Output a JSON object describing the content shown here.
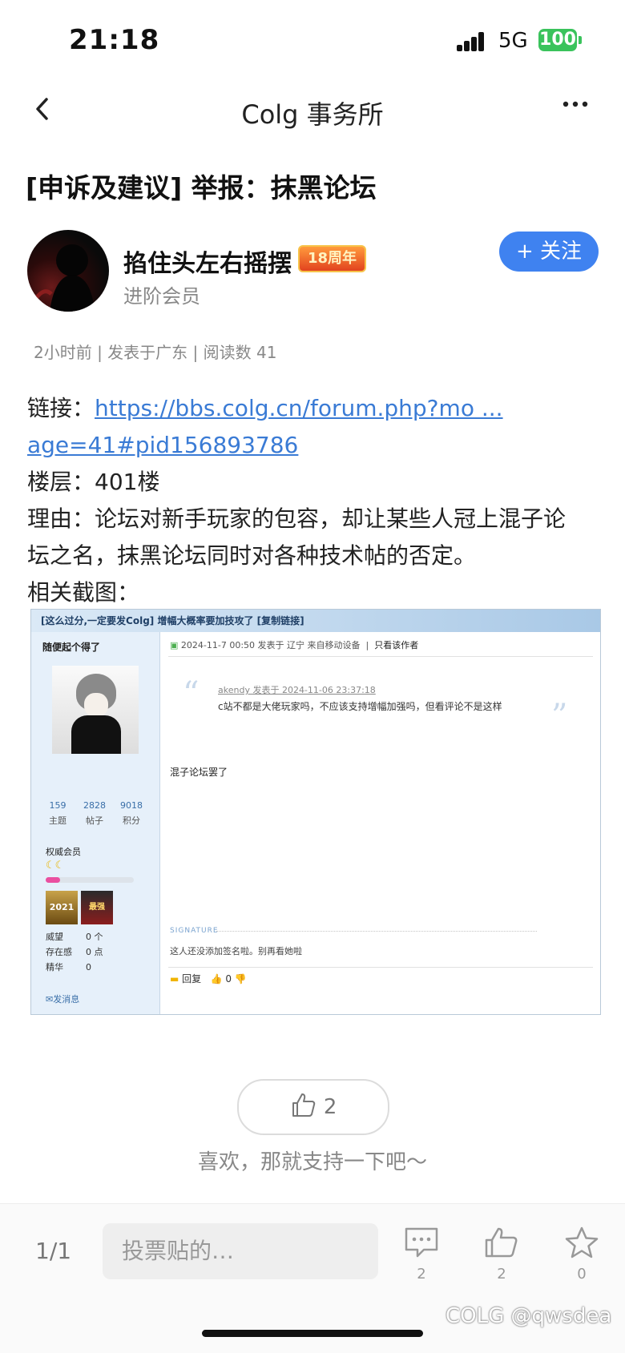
{
  "status": {
    "time": "21:18",
    "network": "5G",
    "battery": "100"
  },
  "nav": {
    "title": "Colg 事务所",
    "back_icon": "chevron-left-icon",
    "more_icon": "more-dots-icon"
  },
  "post": {
    "title": "[申诉及建议] 举报：抹黑论坛",
    "author": {
      "name": "掐住头左右摇摆",
      "badge": "18周年",
      "level": "进阶会员",
      "follow_label": "+ 关注"
    },
    "meta": "2小时前 | 发表于广东 | 阅读数 41",
    "link_label": "链接：",
    "link_line1": "https://bbs.colg.cn/forum.php?mo ...",
    "link_line2": "age=41#pid156893786",
    "floor": "楼层：401楼",
    "reason_line1": "理由：论坛对新手玩家的包容，却让某些人冠上混子论",
    "reason_line2": "坛之名，抹黑论坛同时对各种技术帖的否定。",
    "screenshot_label": "相关截图："
  },
  "screenshot": {
    "header": "[这么过分,一定要发Colg] 增幅大概率要加技攻了 [复制链接]",
    "username": "随便起个得了",
    "stats": [
      {
        "value": "159",
        "label": "主题"
      },
      {
        "value": "2828",
        "label": "帖子"
      },
      {
        "value": "9018",
        "label": "积分"
      }
    ],
    "level": "权威会员",
    "moons": "☾☾",
    "medal1": "2021",
    "medal2": "最强",
    "rows": [
      {
        "label": "威望",
        "value": "0 个"
      },
      {
        "label": "存在感",
        "value": "0 点"
      },
      {
        "label": "精华",
        "value": "0"
      }
    ],
    "send_msg": "发消息",
    "post_info": "2024-11-7 00:50 发表于 辽宁 来自移动设备",
    "only_author": "只看该作者",
    "quote_author": "akendy 发表于 2024-11-06 23:37:18",
    "quote_text": "c站不都是大佬玩家吗，不应该支持增幅加强吗，但看评论不是这样",
    "reply_text": "混子论坛罢了",
    "signature_label": "SIGNATURE",
    "signature_text": "这人还没添加签名啦。别再看她啦",
    "reply_label": "回复",
    "like_count": "0"
  },
  "like": {
    "count": "2",
    "hint": "喜欢，那就支持一下吧～"
  },
  "bottom": {
    "page": "1/1",
    "placeholder": "投票贴的…",
    "comments": "2",
    "likes": "2",
    "favorites": "0"
  },
  "watermark": "COLG @qwsdea"
}
